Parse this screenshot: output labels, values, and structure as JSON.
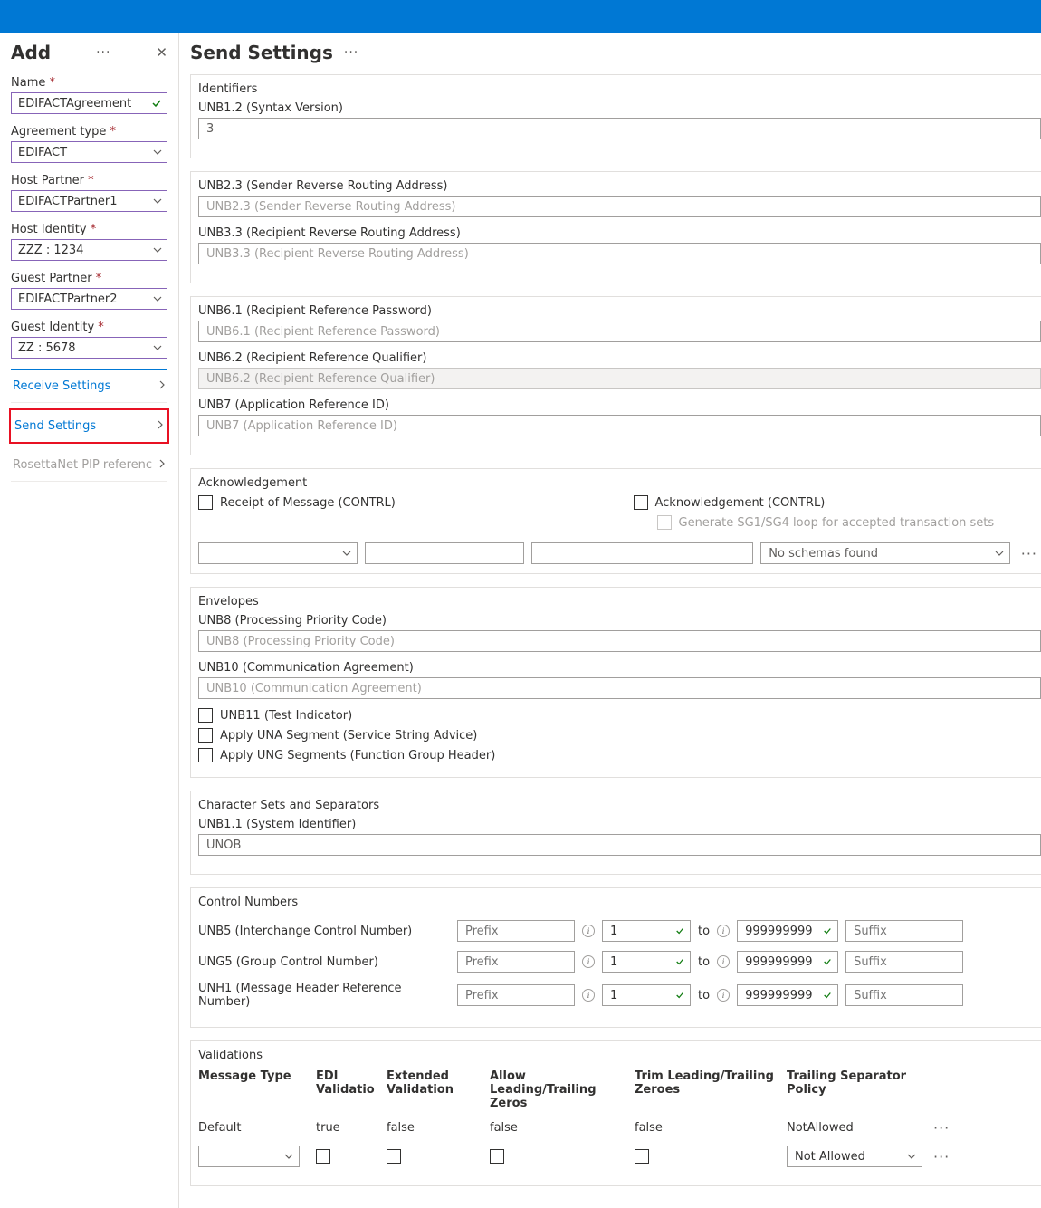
{
  "sidebar": {
    "title": "Add",
    "fields": {
      "name_label": "Name",
      "name_value": "EDIFACTAgreement",
      "agr_type_label": "Agreement type",
      "agr_type_value": "EDIFACT",
      "host_partner_label": "Host Partner",
      "host_partner_value": "EDIFACTPartner1",
      "host_identity_label": "Host Identity",
      "host_identity_value": "ZZZ : 1234",
      "guest_partner_label": "Guest Partner",
      "guest_partner_value": "EDIFACTPartner2",
      "guest_identity_label": "Guest Identity",
      "guest_identity_value": "ZZ : 5678"
    },
    "nav": {
      "receive": "Receive Settings",
      "send": "Send Settings",
      "rosetta": "RosettaNet PIP referenc"
    }
  },
  "main": {
    "title": "Send Settings",
    "identifiers": {
      "title": "Identifiers",
      "unb12_label": "UNB1.2 (Syntax Version)",
      "unb12_value": "3",
      "unb23_label": "UNB2.3 (Sender Reverse Routing Address)",
      "unb23_ph": "UNB2.3 (Sender Reverse Routing Address)",
      "unb33_label": "UNB3.3 (Recipient Reverse Routing Address)",
      "unb33_ph": "UNB3.3 (Recipient Reverse Routing Address)",
      "unb61_label": "UNB6.1 (Recipient Reference Password)",
      "unb61_ph": "UNB6.1 (Recipient Reference Password)",
      "unb62_label": "UNB6.2 (Recipient Reference Qualifier)",
      "unb62_ph": "UNB6.2 (Recipient Reference Qualifier)",
      "unb7_label": "UNB7 (Application Reference ID)",
      "unb7_ph": "UNB7 (Application Reference ID)"
    },
    "ack": {
      "title": "Acknowledgement",
      "receipt": "Receipt of Message (CONTRL)",
      "ack_contrl": "Acknowledgement (CONTRL)",
      "generate": "Generate SG1/SG4 loop for accepted transaction sets",
      "no_schemas": "No schemas found"
    },
    "envelopes": {
      "title": "Envelopes",
      "unb8_label": "UNB8 (Processing Priority Code)",
      "unb8_ph": "UNB8 (Processing Priority Code)",
      "unb10_label": "UNB10 (Communication Agreement)",
      "unb10_ph": "UNB10 (Communication Agreement)",
      "unb11": "UNB11 (Test Indicator)",
      "una": "Apply UNA Segment (Service String Advice)",
      "ung": "Apply UNG Segments (Function Group Header)"
    },
    "charsets": {
      "title": "Character Sets and Separators",
      "unb11_label": "UNB1.1 (System Identifier)",
      "unb11_value": "UNOB"
    },
    "control": {
      "title": "Control Numbers",
      "unb5": "UNB5 (Interchange Control Number)",
      "ung5": "UNG5 (Group Control Number)",
      "unh1": "UNH1 (Message Header Reference Number)",
      "prefix_ph": "Prefix",
      "from_val": "1",
      "to_label": "to",
      "to_val": "999999999",
      "suffix_ph": "Suffix"
    },
    "validations": {
      "title": "Validations",
      "cols": {
        "msg_type": "Message Type",
        "edi": "EDI Validatio",
        "ext": "Extended Validation",
        "allow": "Allow Leading/Trailing Zeros",
        "trim": "Trim Leading/Trailing Zeroes",
        "trail": "Trailing Separator Policy"
      },
      "row1": {
        "msg": "Default",
        "edi": "true",
        "ext": "false",
        "allow": "false",
        "trim": "false",
        "trail": "NotAllowed"
      },
      "not_allowed_sel": "Not Allowed"
    }
  }
}
